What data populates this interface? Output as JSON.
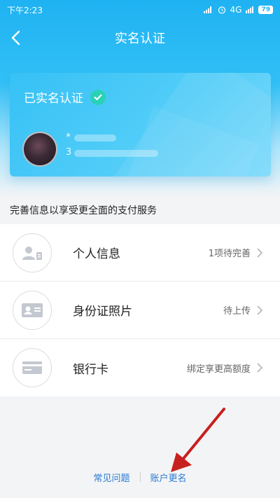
{
  "status_bar": {
    "time": "下午2:23",
    "signal": "4G",
    "battery": "79"
  },
  "nav": {
    "title": "实名认证",
    "back_icon": "chevron-left-icon"
  },
  "card": {
    "verified_label": "已实名认证",
    "user_name_masked": "*",
    "user_id_masked": "3"
  },
  "section_title": "完善信息以享受更全面的支付服务",
  "items": [
    {
      "label": "个人信息",
      "status": "1项待完善",
      "icon": "person-card-icon"
    },
    {
      "label": "身份证照片",
      "status": "待上传",
      "icon": "id-card-icon"
    },
    {
      "label": "银行卡",
      "status": "绑定享更高额度",
      "icon": "bank-card-icon"
    }
  ],
  "footer": {
    "faq": "常见问题",
    "rename": "账户更名"
  },
  "colors": {
    "accent": "#1fb2f2",
    "verified": "#2ad1b6",
    "link": "#2a7bd3",
    "annotation_arrow": "#c8201e"
  }
}
